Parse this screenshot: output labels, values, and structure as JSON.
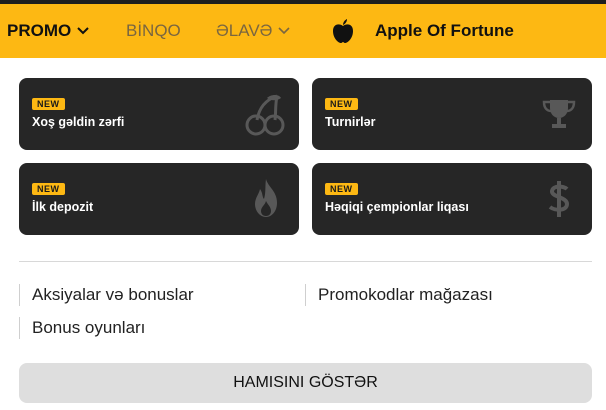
{
  "nav": {
    "promo": "PROMO",
    "bingo": "BİNQO",
    "elave": "ƏLAVƏ",
    "fortune": "Apple Of Fortune"
  },
  "cards": [
    {
      "badge": "NEW",
      "label": "Xoş gəldin zərfi",
      "icon": "cherries-icon"
    },
    {
      "badge": "NEW",
      "label": "Turnirlər",
      "icon": "trophy-icon"
    },
    {
      "badge": "NEW",
      "label": "İlk depozit",
      "icon": "fire-icon"
    },
    {
      "badge": "NEW",
      "label": "Həqiqi çempionlar liqası",
      "icon": "dollar-icon"
    }
  ],
  "links": {
    "promotions": "Aksiyalar və bonuslar",
    "promocodes": "Promokodlar mağazası",
    "bonus_games": "Bonus oyunları"
  },
  "show_all": "HAMISINI GÖSTƏR",
  "colors": {
    "accent": "#fdb813",
    "card_bg": "#262626",
    "topbar": "#1e1e1e"
  }
}
